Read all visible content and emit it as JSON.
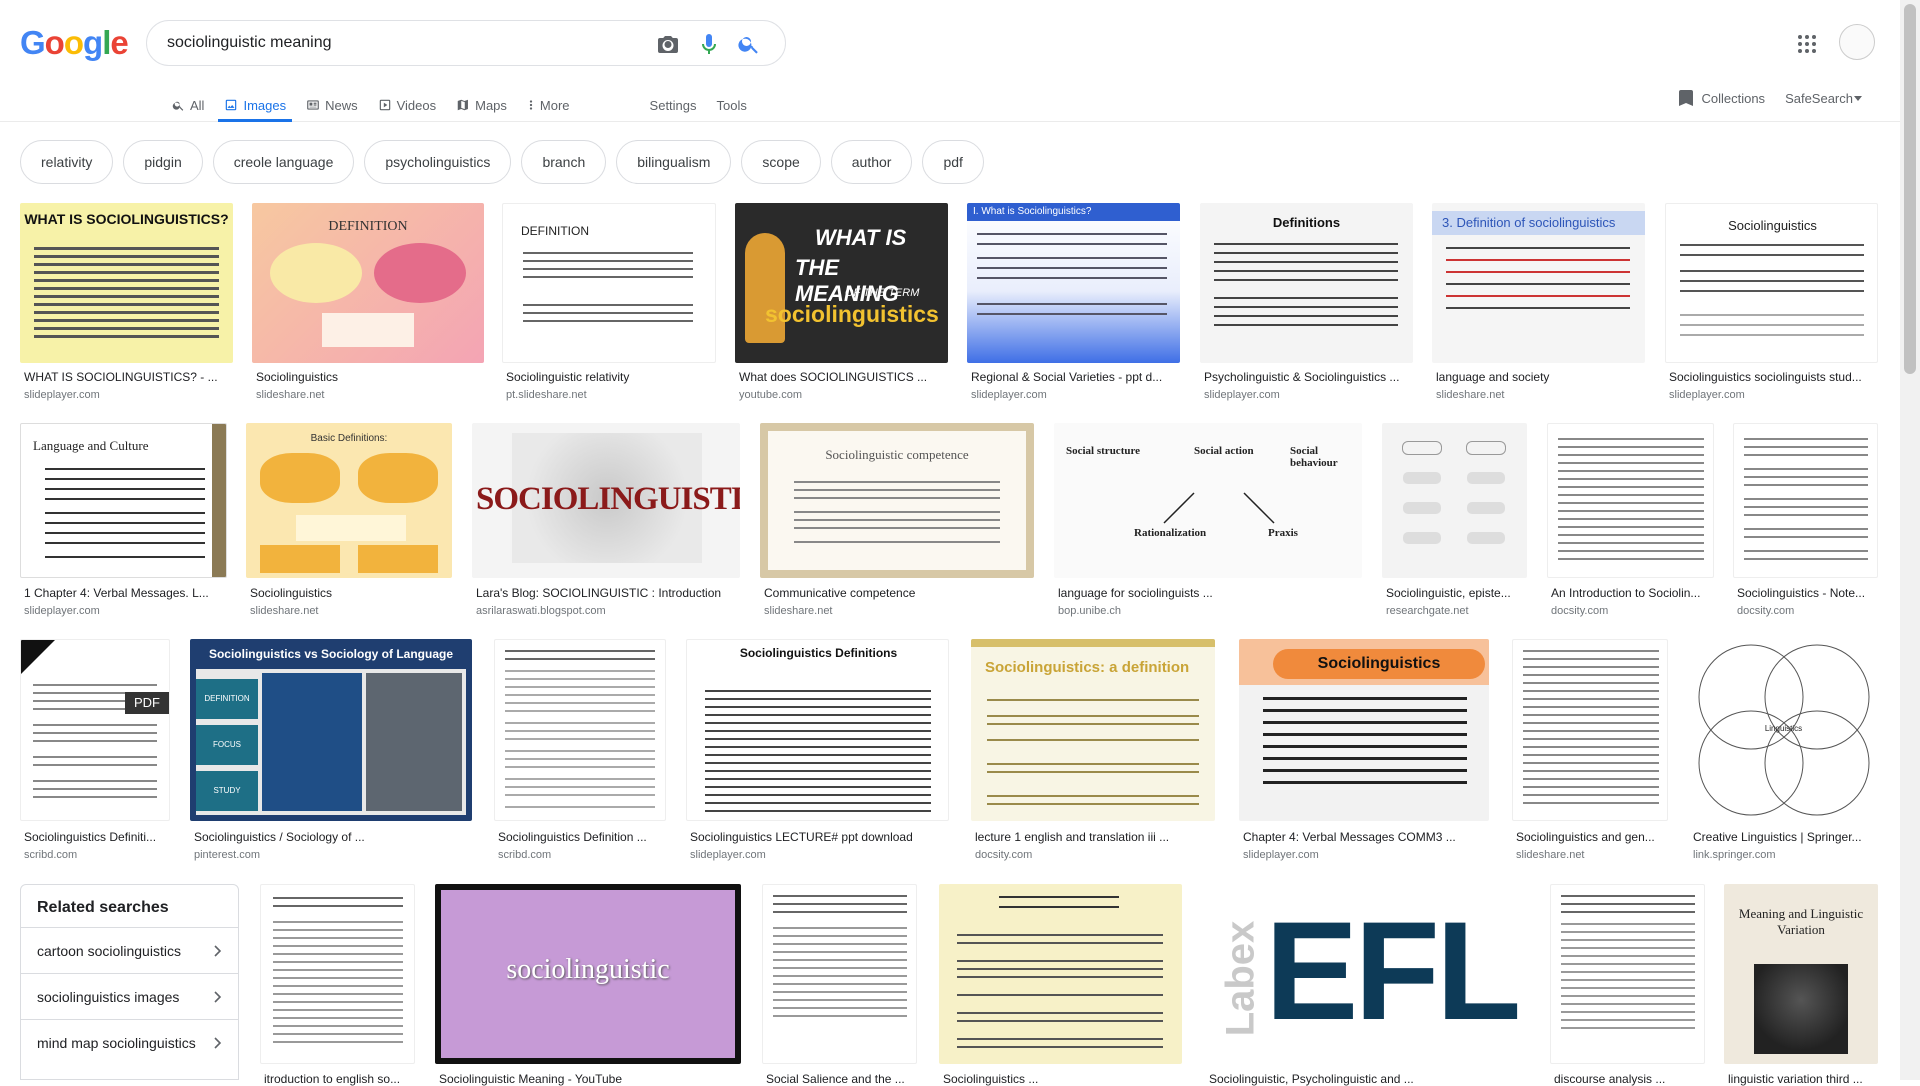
{
  "header": {
    "logo_letters": [
      "G",
      "o",
      "o",
      "g",
      "l",
      "e"
    ],
    "logo_colors": [
      "#4285f4",
      "#ea4335",
      "#fbbc05",
      "#4285f4",
      "#34a853",
      "#ea4335"
    ],
    "query": "sociolinguistic meaning"
  },
  "tabs": [
    {
      "label": "All",
      "icon": "search-icon"
    },
    {
      "label": "Images",
      "icon": "image-icon",
      "active": true
    },
    {
      "label": "News",
      "icon": "news-icon"
    },
    {
      "label": "Videos",
      "icon": "video-icon"
    },
    {
      "label": "Maps",
      "icon": "map-icon"
    },
    {
      "label": "More",
      "icon": "more-vert-icon"
    }
  ],
  "tools": {
    "settings": "Settings",
    "tools": "Tools"
  },
  "right_links": {
    "collections": "Collections",
    "safesearch": "SafeSearch"
  },
  "chips": [
    "relativity",
    "pidgin",
    "creole language",
    "psycholinguistics",
    "branch",
    "bilingualism",
    "scope",
    "author",
    "pdf"
  ],
  "rows": [
    [
      {
        "caption": "WHAT IS SOCIOLINGUISTICS? - ...",
        "source": "slideplayer.com"
      },
      {
        "caption": "Sociolinguistics",
        "source": "slideshare.net"
      },
      {
        "caption": "Sociolinguistic relativity",
        "source": "pt.slideshare.net"
      },
      {
        "caption": "What does SOCIOLINGUISTICS ...",
        "source": "youtube.com"
      },
      {
        "caption": "Regional & Social Varieties - ppt d...",
        "source": "slideplayer.com"
      },
      {
        "caption": "Psycholinguistic & Sociolinguistics ...",
        "source": "slideplayer.com"
      },
      {
        "caption": "language and society",
        "source": "slideshare.net"
      },
      {
        "caption": "Sociolinguistics sociolinguists stud...",
        "source": "slideplayer.com"
      }
    ],
    [
      {
        "caption": "1 Chapter 4: Verbal Messages. L...",
        "source": "slideplayer.com"
      },
      {
        "caption": "Sociolinguistics",
        "source": "slideshare.net"
      },
      {
        "caption": "Lara's Blog: SOCIOLINGUISTIC : Introduction",
        "source": "asrilaraswati.blogspot.com"
      },
      {
        "caption": "Communicative competence",
        "source": "slideshare.net"
      },
      {
        "caption": "language for sociolinguists ...",
        "source": "bop.unibe.ch"
      },
      {
        "caption": "Sociolinguistic, episte...",
        "source": "researchgate.net"
      },
      {
        "caption": "An Introduction to Sociolin...",
        "source": "docsity.com"
      },
      {
        "caption": "Sociolinguistics - Note...",
        "source": "docsity.com"
      }
    ],
    [
      {
        "caption": "Sociolinguistics Definiti...",
        "source": "scribd.com"
      },
      {
        "caption": "Sociolinguistics / Sociology of ...",
        "source": "pinterest.com"
      },
      {
        "caption": "Sociolinguistics Definition ...",
        "source": "scribd.com"
      },
      {
        "caption": "Sociolinguistics LECTURE# ppt download",
        "source": "slideplayer.com"
      },
      {
        "caption": "lecture 1 english and translation iii ...",
        "source": "docsity.com"
      },
      {
        "caption": "Chapter 4: Verbal Messages COMM3 ...",
        "source": "slideplayer.com"
      },
      {
        "caption": "Sociolinguistics and gen...",
        "source": "slideshare.net"
      },
      {
        "caption": "Creative Linguistics | Springer...",
        "source": "link.springer.com"
      }
    ],
    [
      {
        "caption": "itroduction to english so..."
      },
      {
        "caption": "Sociolinguistic Meaning - YouTube"
      },
      {
        "caption": "Social Salience and the ..."
      },
      {
        "caption": "Sociolinguistics ..."
      },
      {
        "caption": "Sociolinguistic, Psycholinguistic and ..."
      },
      {
        "caption": "discourse analysis ..."
      },
      {
        "caption": "linguistic variation third ..."
      }
    ]
  ],
  "thumb_text": {
    "r0c0_title": "WHAT IS SOCIOLINGUISTICS?",
    "r0c1_title": "DEFINITION",
    "r0c2_title": "DEFINITION",
    "r0c3_line1": "WHAT IS",
    "r0c3_line2": "THE MEANING",
    "r0c3_line3": "OF THE TERM",
    "r0c3_line4": "sociolinguistics",
    "r0c4_title": "I. What is Sociolinguistics?",
    "r0c5_title": "Definitions",
    "r0c6_title": "3. Definition of sociolinguistics",
    "r0c7_title": "Sociolinguistics",
    "r1c0_title": "Language and Culture",
    "r1c1_title": "Basic Definitions:",
    "r1c2_title": "SOCIOLINGUISTICS",
    "r1c3_title": "Sociolinguistic competence",
    "r1c4_a": "Social structure",
    "r1c4_b": "Social action",
    "r1c4_c": "Social behaviour",
    "r1c4_d": "Rationalization",
    "r1c4_e": "Praxis",
    "r2c0_pdf": "PDF",
    "r2c1_title": "Sociolinguistics vs Sociology of Language",
    "r2c1_l1": "DEFINITION",
    "r2c1_l2": "FOCUS",
    "r2c1_l3": "STUDY",
    "r2c3_title": "Sociolinguistics Definitions",
    "r2c4_title": "Sociolinguistics: a definition",
    "r2c5_title": "Sociolinguistics",
    "r2c7_center": "Linguistics",
    "r3c1_title": "sociolinguistic",
    "r3c4_side": "Labex",
    "r3c4_main": "EFL",
    "r3c6_title": "Meaning and Linguistic Variation"
  },
  "related": {
    "title": "Related searches",
    "items": [
      "cartoon sociolinguistics",
      "sociolinguistics images",
      "mind map sociolinguistics"
    ]
  }
}
